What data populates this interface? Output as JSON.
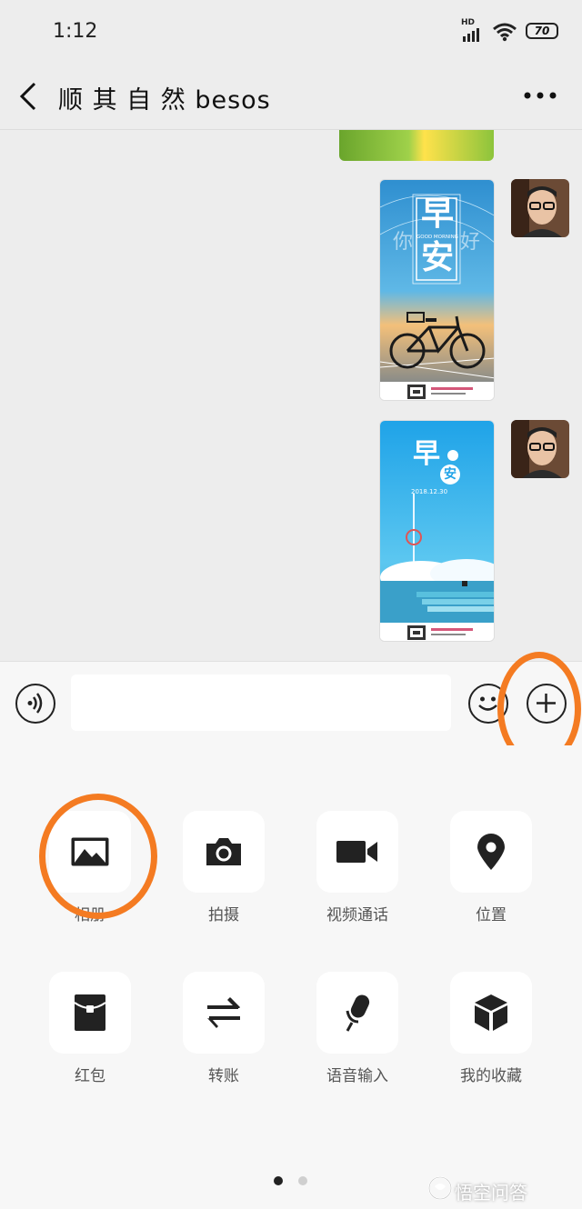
{
  "status_bar": {
    "time": "1:12",
    "network": "HD",
    "battery": "70"
  },
  "header": {
    "title": "顺 其 自 然 besos"
  },
  "messages": [
    {
      "type": "image",
      "card_text": {
        "big1": "早",
        "big2": "安",
        "sub": "GOOD MORNING",
        "left": "你",
        "right": "好"
      }
    },
    {
      "type": "image",
      "card_text": {
        "big1": "早",
        "big2": "安",
        "date": "2018.12.30"
      }
    }
  ],
  "input": {
    "value": ""
  },
  "tools": [
    {
      "label": "相册",
      "icon": "album-icon"
    },
    {
      "label": "拍摄",
      "icon": "camera-icon"
    },
    {
      "label": "视频通话",
      "icon": "video-call-icon"
    },
    {
      "label": "位置",
      "icon": "location-icon"
    },
    {
      "label": "红包",
      "icon": "red-packet-icon"
    },
    {
      "label": "转账",
      "icon": "transfer-icon"
    },
    {
      "label": "语音输入",
      "icon": "voice-input-icon"
    },
    {
      "label": "我的收藏",
      "icon": "favorites-icon"
    }
  ],
  "pagination": {
    "current": 1,
    "total": 2
  },
  "watermark": "悟空问答",
  "colors": {
    "highlight": "#f47b22",
    "background": "#ededed",
    "panel": "#f7f7f7"
  }
}
